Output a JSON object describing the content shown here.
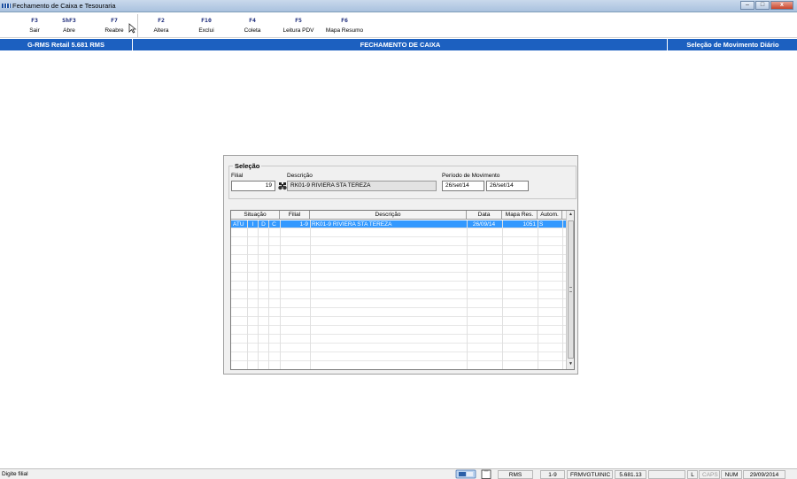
{
  "window": {
    "title": "Fechamento de Caixa e Tesouraria",
    "buttons": {
      "minimize": "–",
      "maximize": "□",
      "close": "x"
    }
  },
  "toolbar": {
    "items": [
      {
        "key": "F3",
        "label": "Sair"
      },
      {
        "key": "ShF3",
        "label": "Abre"
      },
      {
        "key": "F7",
        "label": "Reabre"
      },
      {
        "key": "F2",
        "label": "Altera"
      },
      {
        "key": "F10",
        "label": "Exclui"
      },
      {
        "key": "F4",
        "label": "Coleta"
      },
      {
        "key": "F5",
        "label": "Leitura PDV"
      },
      {
        "key": "F6",
        "label": "Mapa Resumo"
      }
    ]
  },
  "header": {
    "left": "G-RMS Retail 5.681 RMS",
    "center": "FECHAMENTO DE CAIXA",
    "right": "Seleção de Movimento Diário"
  },
  "selecao": {
    "title": "Seleção",
    "filial_label": "Filial",
    "filial_value": "19",
    "descricao_label": "Descrição",
    "descricao_value": "RK01-9 RIVIERA STA TEREZA",
    "periodo_label": "Período de Movimento",
    "periodo_inicio": "26/set/14",
    "periodo_fim": "26/set/14"
  },
  "grid": {
    "columns": {
      "situacao": "Situação",
      "filial": "Filial",
      "descricao": "Descrição",
      "data": "Data",
      "mapa": "Mapa Res.",
      "autom": "Autom."
    },
    "rows": [
      {
        "s1": "ATU",
        "s2": "I",
        "s3": "D",
        "s4": "C",
        "filial": "1-9",
        "descricao": "RK01-9 RIVIERA STA TEREZA",
        "data": "26/09/14",
        "mapa": "1051",
        "autom": "S"
      }
    ],
    "scroll": {
      "up": "▲",
      "down": "▼"
    }
  },
  "statusbar": {
    "message": "Digite filial",
    "cells": {
      "system": "RMS",
      "range": "1-9",
      "form": "FRMVGTUINIC",
      "version": "5.681.13",
      "blank": "",
      "l": "L",
      "caps": "CAPS",
      "num": "NUM",
      "date": "29/09/2014"
    }
  }
}
